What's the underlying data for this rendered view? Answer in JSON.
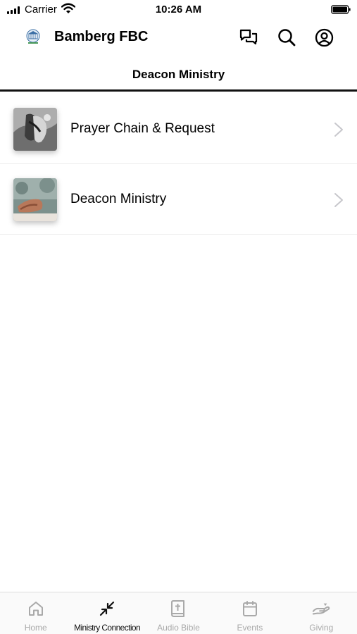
{
  "status_bar": {
    "carrier": "Carrier",
    "time": "10:26 AM"
  },
  "header": {
    "app_title": "Bamberg FBC",
    "icons": [
      "chat-icon",
      "search-icon",
      "profile-icon"
    ]
  },
  "page": {
    "title": "Deacon Ministry"
  },
  "list": {
    "items": [
      {
        "label": "Prayer Chain & Request"
      },
      {
        "label": "Deacon Ministry"
      }
    ]
  },
  "tab_bar": {
    "active": "Ministry Connection",
    "tabs": [
      {
        "label": "Home",
        "icon": "home-icon"
      },
      {
        "label": "Ministry Connection",
        "icon": "arrows-inward-icon"
      },
      {
        "label": "Audio Bible",
        "icon": "bible-icon"
      },
      {
        "label": "Events",
        "icon": "calendar-icon"
      },
      {
        "label": "Giving",
        "icon": "giving-hand-icon"
      }
    ]
  },
  "colors": {
    "active": "#111111",
    "inactive": "#a9a9a9",
    "divider": "#ececec"
  }
}
